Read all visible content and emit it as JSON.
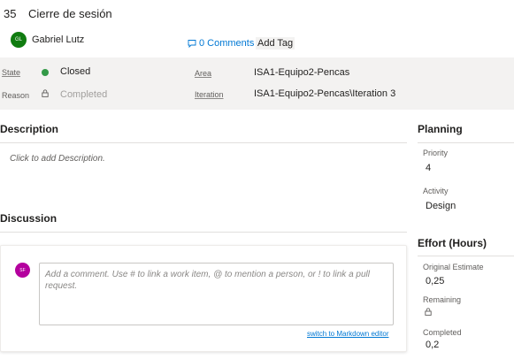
{
  "work_item": {
    "id": "35",
    "title": "Cierre de sesión"
  },
  "author": {
    "initials": "GL",
    "name": "Gabriel Lutz",
    "avatar_color": "#107c10"
  },
  "actions": {
    "comments_label": "0 Comments",
    "add_tag_label": "Add Tag"
  },
  "fields": {
    "state_label": "State",
    "state_value": "Closed",
    "state_color": "#339947",
    "reason_label": "Reason",
    "reason_value": "Completed",
    "area_label": "Area",
    "area_value": "ISA1-Equipo2-Pencas",
    "iteration_label": "Iteration",
    "iteration_value": "ISA1-Equipo2-Pencas\\Iteration 3"
  },
  "description": {
    "title": "Description",
    "placeholder": "Click to add Description."
  },
  "discussion": {
    "title": "Discussion",
    "commenter_initials": "SF",
    "commenter_color": "#b4009e",
    "placeholder": "Add a comment. Use # to link a work item, @ to mention a person, or ! to link a pull request.",
    "markdown_link": "switch to Markdown editor"
  },
  "planning": {
    "title": "Planning",
    "priority_label": "Priority",
    "priority_value": "4",
    "activity_label": "Activity",
    "activity_value": "Design"
  },
  "effort": {
    "title": "Effort (Hours)",
    "original_label": "Original Estimate",
    "original_value": "0,25",
    "remaining_label": "Remaining",
    "completed_label": "Completed",
    "completed_value": "0,2"
  },
  "colors": {
    "accent": "#0078d4",
    "band_bg": "#f3f2f1"
  }
}
